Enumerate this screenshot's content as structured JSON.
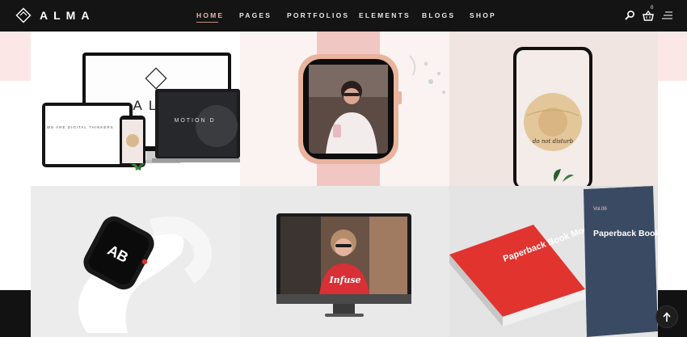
{
  "brand": {
    "name": "ALMA"
  },
  "nav": {
    "items": [
      {
        "label": "HOME",
        "active": true
      },
      {
        "label": "PAGES",
        "active": false
      },
      {
        "label": "PORTFOLIOS",
        "active": false
      },
      {
        "label": "ELEMENTS",
        "active": false
      },
      {
        "label": "BLOGS",
        "active": false
      },
      {
        "label": "SHOP",
        "active": false
      }
    ]
  },
  "header_icons": [
    "search-icon",
    "cart-icon",
    "menu-icon"
  ],
  "cart": {
    "count": "0"
  },
  "portfolio": {
    "tiles": [
      {
        "title": "ALM",
        "screen_title": "MOTION D",
        "tagline": "WE ARE DIGITAL THINKERS"
      },
      {
        "title": ""
      },
      {
        "title": "",
        "hat_text": "do not disturb"
      },
      {
        "title": "",
        "watch_mark": "AB"
      },
      {
        "title": "",
        "shirt_text": "Infuse"
      },
      {
        "title": "",
        "book_title": "Paperback Book Mockup.",
        "book_vol": "Vol.06"
      }
    ]
  },
  "colors": {
    "accent": "#e7b6a8",
    "header_bg": "#141414",
    "pink_band": "#fbe8e6"
  }
}
